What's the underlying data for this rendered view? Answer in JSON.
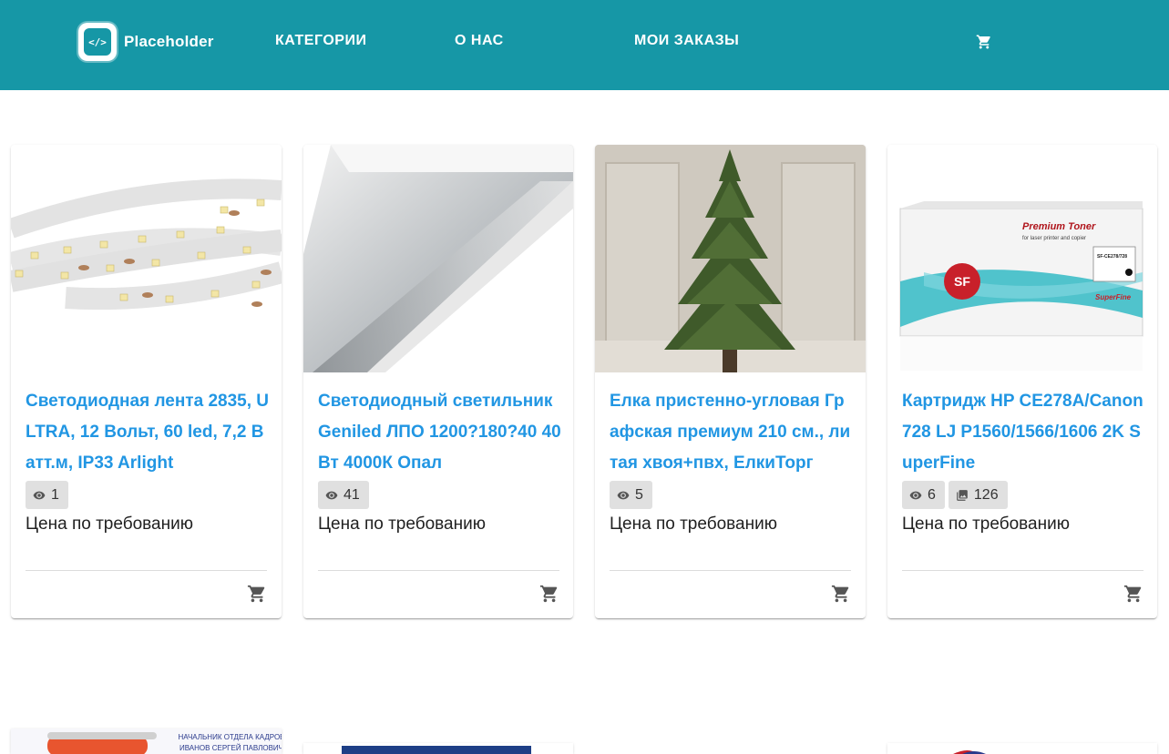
{
  "header": {
    "logo_icon_text": "</>",
    "logo_text": "Placeholder",
    "nav": [
      {
        "label": "КАТЕГОРИИ"
      },
      {
        "label": "О НАС"
      },
      {
        "label": "МОИ ЗАКАЗЫ"
      }
    ],
    "cart_icon": "cart-icon",
    "bg_color": "#1697a6"
  },
  "products": [
    {
      "title": "Светодиодная лента 2835, ULTRA, 12 Вольт, 60 led, 7,2 Ватт.м, IP33 Arlight",
      "views": "1",
      "price": "Цена по требованию"
    },
    {
      "title": "Светодиодный светильник Geniled ЛПО 1200?180?40 40Вт 4000К Опал",
      "views": "41",
      "price": "Цена по требованию"
    },
    {
      "title": "Елка пристенно-угловая Графская премиум 210 см., литая хвоя+пвх, ЕлкиТорг",
      "views": "5",
      "price": "Цена по требованию"
    },
    {
      "title": "Картридж HP CE278A/Canon 728 LJ P1560/1566/1606 2K SuperFine",
      "views": "6",
      "pages": "126",
      "price": "Цена по требованию"
    }
  ],
  "image_texts": {
    "toner_brand": "Premium Toner",
    "toner_sub": "for laser printer and copier",
    "toner_sku": "SF-CE278/728",
    "toner_series": "SuperFine",
    "badge_line1": "НАЧАЛЬНИК ОТДЕЛА КАДРОВ",
    "badge_line2": "ИВАНОВ СЕРГЕЙ ПАВЛОВИЧ"
  },
  "colors": {
    "accent": "#2196e3",
    "chip_bg": "#e0e0e0"
  }
}
